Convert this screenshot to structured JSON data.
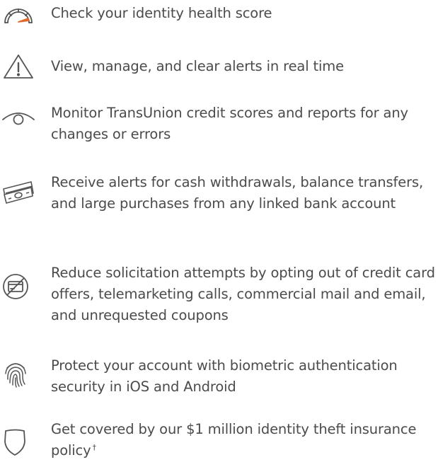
{
  "features": [
    {
      "icon": "speedometer-icon",
      "text": "Check your identity health score"
    },
    {
      "icon": "warning-icon",
      "text": "View, manage, and clear alerts in real time"
    },
    {
      "icon": "eye-icon",
      "text": "Monitor TransUnion credit scores and reports for any changes or errors"
    },
    {
      "icon": "cash-icon",
      "text": "Receive alerts for cash withdrawals, balance transfers, and large purchases from any linked bank account"
    },
    {
      "icon": "no-credit-card-icon",
      "text": "Reduce solicitation attempts by opting out of credit card offers, telemarketing calls, commercial mail and email, and unrequested coupons"
    },
    {
      "icon": "fingerprint-icon",
      "text": "Protect your account with biometric authentication security in iOS and Android"
    },
    {
      "icon": "shield-icon",
      "text": "Get covered by our $1 million identity theft insurance policy",
      "footnote": "†"
    }
  ],
  "colors": {
    "text": "#4b4b4b",
    "icon_stroke": "#555555",
    "icon_accent": "#e06a2c"
  }
}
